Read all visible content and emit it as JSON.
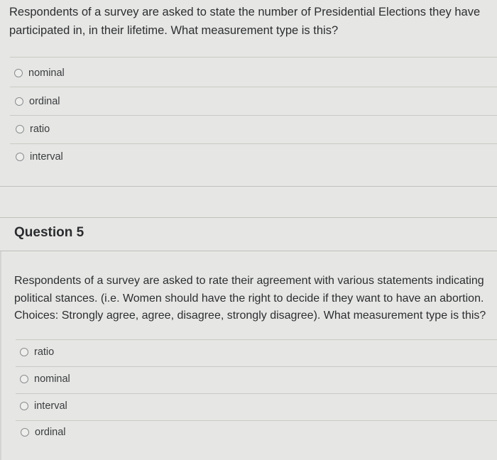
{
  "question4": {
    "text": "Respondents of a survey are asked to state the number of Presidential Elections they have participated in, in their lifetime. What measurement type is this?",
    "options": [
      "nominal",
      "ordinal",
      "ratio",
      "interval"
    ]
  },
  "question5": {
    "header": "Question 5",
    "text": "Respondents of a survey are asked to rate their agreement with various statements indicating political stances. (i.e. Women should have the right to decide if they want to have an abortion. Choices: Strongly agree, agree, disagree, strongly disagree). What measurement type is this?",
    "options": [
      "ratio",
      "nominal",
      "interval",
      "ordinal"
    ]
  }
}
